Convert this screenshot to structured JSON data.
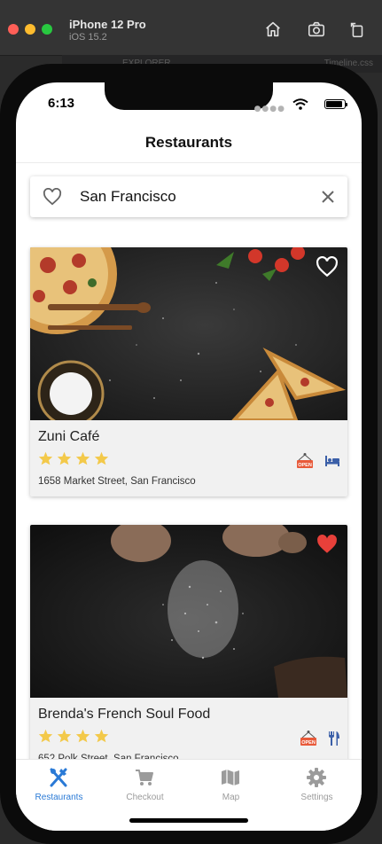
{
  "simulator": {
    "device_name": "iPhone 12 Pro",
    "os_version": "iOS 15.2",
    "bg_tab_left": "EXPLORER",
    "bg_tab_right": "Timeline.css"
  },
  "status_bar": {
    "time": "6:13"
  },
  "nav": {
    "title": "Restaurants"
  },
  "search": {
    "value": "San Francisco",
    "favorite_icon": "heart-outline-icon",
    "clear_icon": "close-icon"
  },
  "restaurants": [
    {
      "name": "Zuni Café",
      "rating": 4,
      "address": "1658 Market Street, San Francisco",
      "favorite": false,
      "amenities": [
        "open-sign-icon",
        "bed-icon"
      ]
    },
    {
      "name": "Brenda's French Soul Food",
      "rating": 4,
      "address": "652 Polk Street, San Francisco",
      "favorite": true,
      "amenities": [
        "open-sign-icon",
        "fork-knife-icon"
      ]
    }
  ],
  "tabs": [
    {
      "label": "Restaurants",
      "icon": "fork-knife-icon",
      "active": true
    },
    {
      "label": "Checkout",
      "icon": "cart-icon",
      "active": false
    },
    {
      "label": "Map",
      "icon": "map-icon",
      "active": false
    },
    {
      "label": "Settings",
      "icon": "gear-icon",
      "active": false
    }
  ],
  "colors": {
    "accent": "#2a7ad6",
    "star": "#f3c94a",
    "heart_filled": "#e8403a",
    "inactive_tab": "#9b9b9b"
  }
}
